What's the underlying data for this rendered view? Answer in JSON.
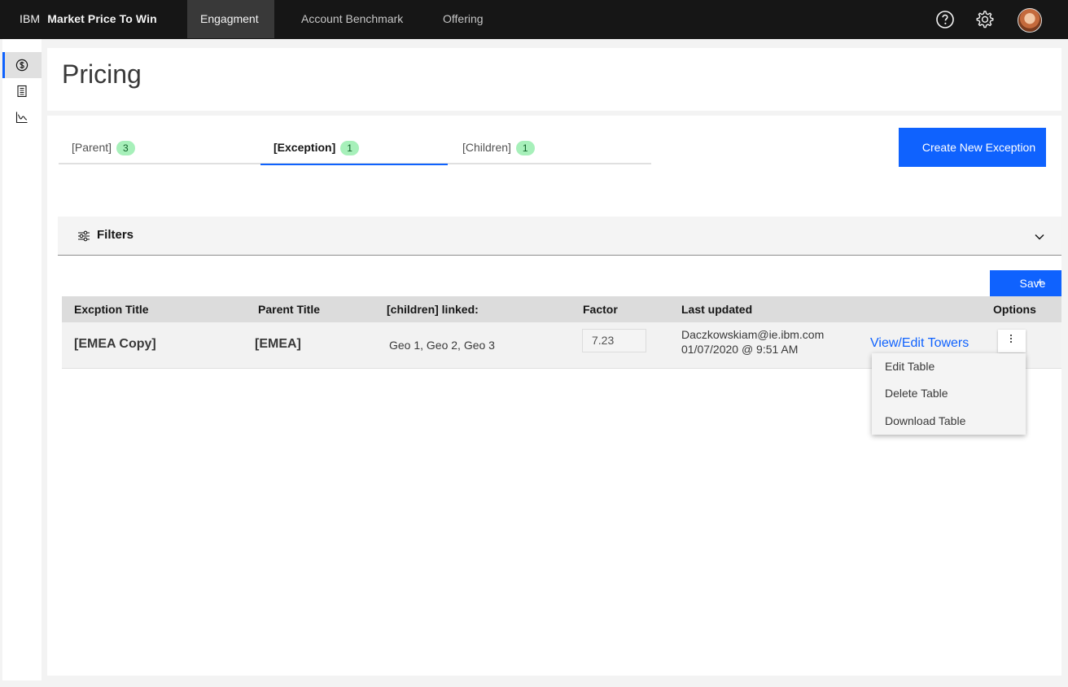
{
  "header": {
    "brand_ibm": "IBM",
    "brand_product": "Market Price To Win",
    "nav": [
      {
        "label": "Engagment",
        "active": true
      },
      {
        "label": "Account Benchmark",
        "active": false
      },
      {
        "label": "Offering",
        "active": false
      }
    ],
    "icons": [
      "help-icon",
      "settings-icon",
      "user-avatar"
    ]
  },
  "sidebar": {
    "items": [
      {
        "icon": "currency-icon",
        "active": true
      },
      {
        "icon": "catalog-icon",
        "active": false
      },
      {
        "icon": "chart-line-icon",
        "active": false
      }
    ]
  },
  "page": {
    "title": "Pricing"
  },
  "tabs": [
    {
      "label": "[Parent]",
      "count": "3",
      "active": false
    },
    {
      "label": "[Exception]",
      "count": "1",
      "active": true
    },
    {
      "label": "[Children]",
      "count": "1",
      "active": false
    }
  ],
  "actions": {
    "create_label": "Create New Exception",
    "save_label": "Save",
    "save_icon": "+"
  },
  "filters": {
    "label": "Filters"
  },
  "table": {
    "headers": [
      "Excption Title",
      "Parent Title",
      "[children] linked:",
      "Factor",
      "Last updated",
      "Options"
    ],
    "rows": [
      {
        "title": "[EMEA Copy]",
        "parent": "[EMEA]",
        "children": "Geo 1, Geo 2, Geo 3",
        "factor": "7.23",
        "updated_by": "Daczkowskiam@ie.ibm.com",
        "updated_at": "01/07/2020 @ 9:51 AM",
        "link": "View/Edit Towers"
      }
    ]
  },
  "overflow_menu": {
    "items": [
      "Edit Table",
      "Delete Table",
      "Download Table"
    ]
  },
  "colors": {
    "header_bg": "#161616",
    "primary": "#0f62fe",
    "badge_bg": "#a7f0ba"
  }
}
